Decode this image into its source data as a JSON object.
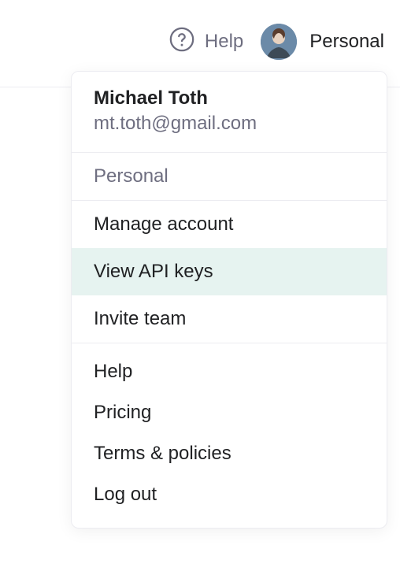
{
  "topbar": {
    "help_label": "Help",
    "account_label": "Personal"
  },
  "dropdown": {
    "user_name": "Michael Toth",
    "user_email": "mt.toth@gmail.com",
    "workspace_label": "Personal",
    "items_upper": {
      "manage_account": "Manage account",
      "view_api_keys": "View API keys",
      "invite_team": "Invite team"
    },
    "items_lower": {
      "help": "Help",
      "pricing": "Pricing",
      "terms": "Terms & policies",
      "log_out": "Log out"
    }
  }
}
